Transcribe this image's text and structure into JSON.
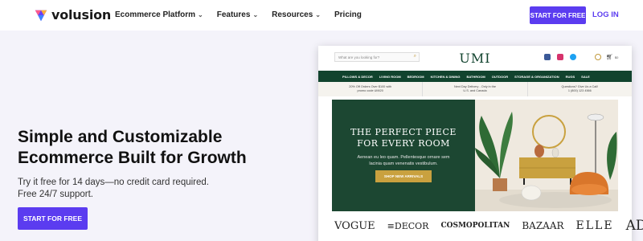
{
  "header": {
    "logo_text": "volusion",
    "nav": [
      {
        "label": "Ecommerce Platform",
        "has_dropdown": true
      },
      {
        "label": "Features",
        "has_dropdown": true
      },
      {
        "label": "Resources",
        "has_dropdown": true
      },
      {
        "label": "Pricing",
        "has_dropdown": false
      }
    ],
    "cta_label": "START FOR FREE",
    "login_label": "LOG IN",
    "accent_color": "#5b3cf0"
  },
  "hero": {
    "title": "Simple and Customizable Ecommerce Built for Growth",
    "subtitle_line1": "Try it free for 14 days—no credit card required.",
    "subtitle_line2": "Free 24/7 support.",
    "cta_label": "START FOR FREE"
  },
  "store_mock": {
    "search_placeholder": "What are you looking for?",
    "brand": "UMI",
    "cart_count": "$0",
    "nav": [
      "PILLOWS & DECOR",
      "LIVING ROOM",
      "BEDROOM",
      "KITCHEN & DINING",
      "BATHROOM",
      "OUTDOOR",
      "STORAGE & ORGANIZATION",
      "RUGS",
      "SALE"
    ],
    "promos": [
      {
        "line1": "20% Off Orders Over $100 with",
        "line2": "promo code UMI20"
      },
      {
        "line1": "Next Day Delivery - Only in the",
        "line2": "U.S. and Canada"
      },
      {
        "line1": "Questions? Give Us a Call!",
        "line2": "1 (800) 123 4566"
      }
    ],
    "hero_title_line1": "THE PERFECT PIECE",
    "hero_title_line2": "FOR EVERY ROOM",
    "hero_text_line1": "Aenean eu leo quam. Pellentesque ornare sem",
    "hero_text_line2": "lacinia quam venenatis vestibulum.",
    "hero_button": "SHOP NEW ARRIVALS",
    "brand_logos": [
      "VOGUE",
      "≡DECOR",
      "COSMOPOLITAN",
      "BAZAAR",
      "ELLE",
      "AD"
    ],
    "theme_color": "#11432e",
    "gold_color": "#c9a13f"
  }
}
